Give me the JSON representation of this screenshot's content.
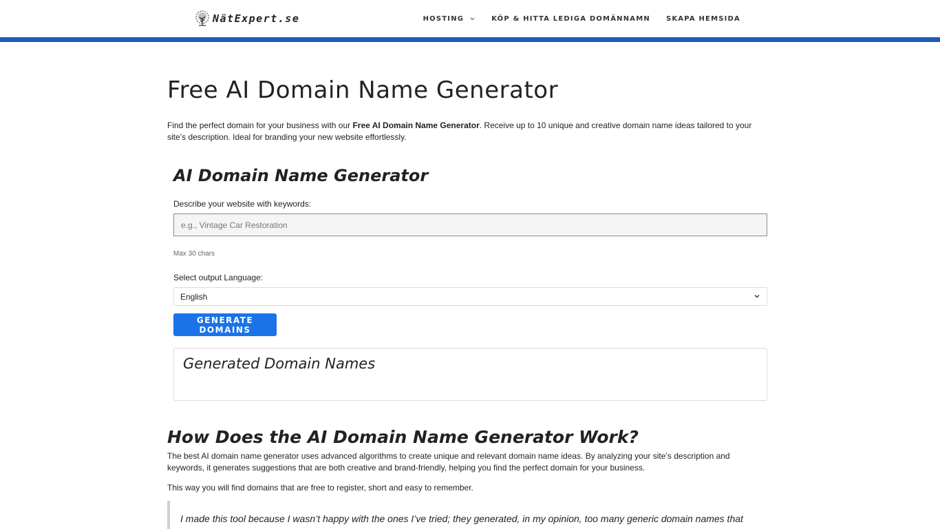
{
  "header": {
    "logo_text": "NätExpert.se",
    "nav": [
      {
        "label": "HOSTING",
        "has_dropdown": true
      },
      {
        "label": "KÖP & HITTA LEDIGA DOMÄNNAMN",
        "has_dropdown": false
      },
      {
        "label": "SKAPA HEMSIDA",
        "has_dropdown": false
      }
    ],
    "bar_color": "#1e5cb3"
  },
  "page": {
    "title": "Free AI Domain Name Generator",
    "intro_part1": "Find the perfect domain for your business with our ",
    "intro_bold": "Free AI Domain Name Generator",
    "intro_part2": ". Receive up to 10 unique and creative domain name ideas tailored to your site’s description. Ideal for branding your new website effortlessly."
  },
  "tool": {
    "title": "AI Domain Name Generator",
    "keywords_label": "Describe your website with keywords:",
    "keywords_placeholder": "e.g., Vintage Car Restoration",
    "keywords_value": "",
    "hint": "Max 30 chars",
    "language_label": "Select output Language:",
    "language_selected": "English",
    "generate_label": "GENERATE DOMAINS",
    "button_color": "#1a73e8",
    "results_title": "Generated Domain Names"
  },
  "how": {
    "heading": "How Does the AI Domain Name Generator Work?",
    "paragraph1": "The best AI domain name generator uses advanced algorithms to create unique and relevant domain name ideas. By analyzing your site’s description and keywords, it generates suggestions that are both creative and brand-friendly, helping you find the perfect domain for your business.",
    "paragraph2": "This way you will find domains that are free to register, short and easy to remember.",
    "quote": "I made this tool because I wasn’t happy with the ones I’ve tried; they generated, in my opinion, too many generic domain names that weren’t"
  }
}
